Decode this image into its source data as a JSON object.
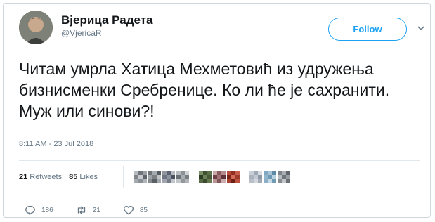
{
  "tweet": {
    "author_name": "Вјерица Радета",
    "author_handle": "@VjericaR",
    "follow_label": "Follow",
    "text": "Читам умрла Хатица Мехметовић из удружења бизнисменки Сребренице. Ко ли ће је сахранити. Муж или синови?!",
    "timestamp": "8:11 AM - 23 Jul 2018"
  },
  "stats": {
    "retweets_count": "21",
    "retweets_label": "Retweets",
    "likes_count": "85",
    "likes_label": "Likes"
  },
  "actions": {
    "reply_count": "186",
    "retweet_count": "21",
    "like_count": "85"
  },
  "icons": [
    "avatar",
    "chevron-down-icon",
    "reply-icon",
    "retweet-icon",
    "heart-icon"
  ],
  "colors": {
    "accent": "#1da1f2",
    "text": "#14171a",
    "muted": "#657786",
    "border": "#e1e8ed"
  }
}
